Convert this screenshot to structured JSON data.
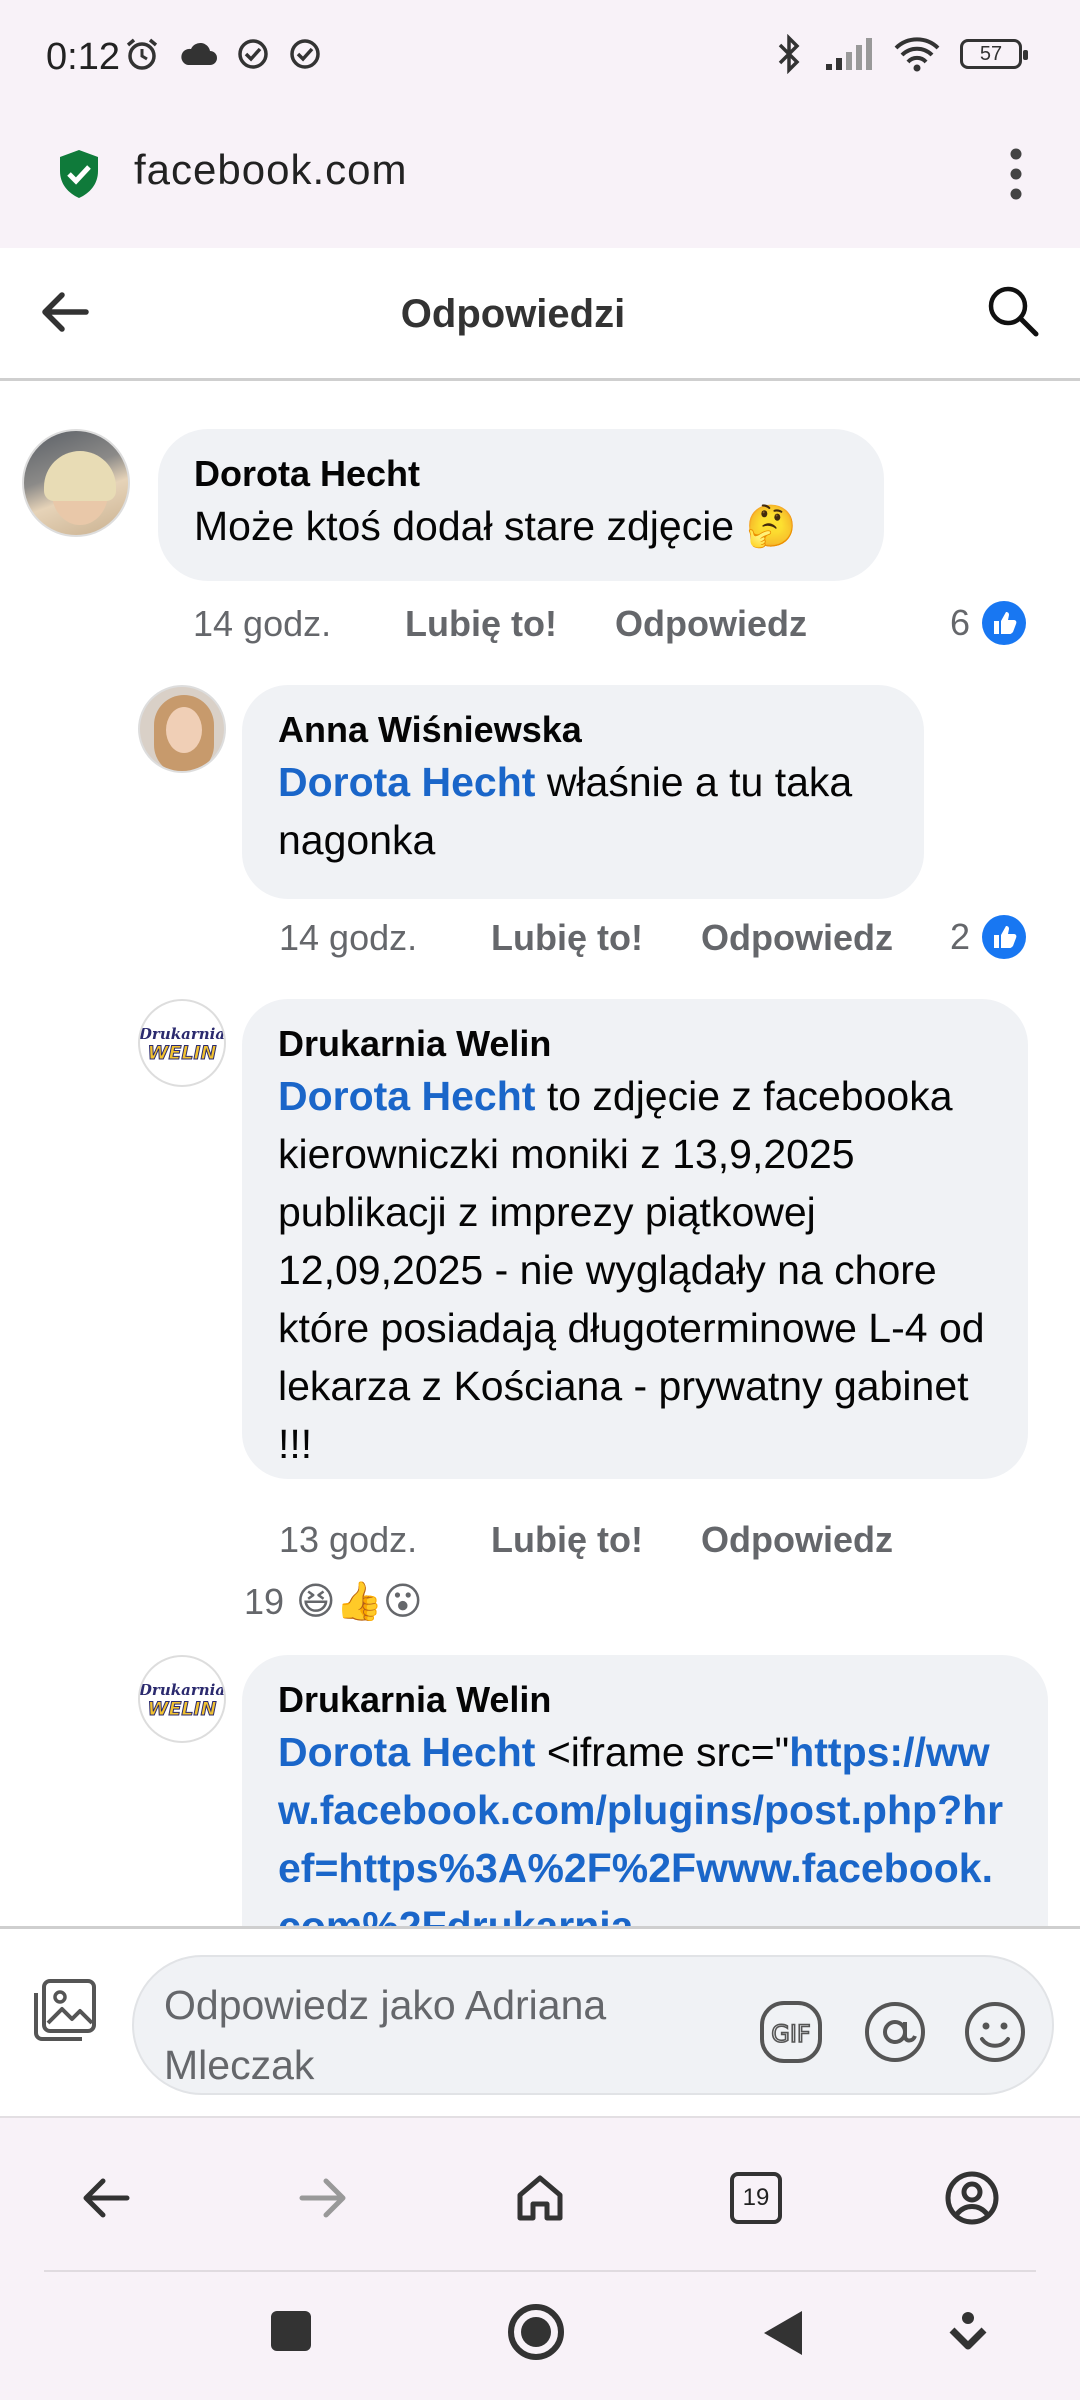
{
  "status_bar": {
    "time": "0:12",
    "battery": "57"
  },
  "browser": {
    "url": "facebook.com",
    "tab_count": "19"
  },
  "header": {
    "title": "Odpowiedzi"
  },
  "comments": [
    {
      "author": "Dorota Hecht",
      "text": "Może ktoś dodał stare zdjęcie 🤔",
      "time": "14 godz.",
      "like_label": "Lubię to!",
      "reply_label": "Odpowiedz",
      "reactions": "6"
    },
    {
      "author": "Anna Wiśniewska",
      "mention": "Dorota Hecht",
      "text": " właśnie a tu taka nagonka",
      "time": "14 godz.",
      "like_label": "Lubię to!",
      "reply_label": "Odpowiedz",
      "reactions": "2"
    },
    {
      "author": "Drukarnia Welin",
      "mention": "Dorota Hecht",
      "text": " to zdjęcie z facebooka kierowniczki moniki z 13,9,2025 publikacji z imprezy piątkowej 12,09,2025 - nie wyglądały na chore które posiadają długoterminowe L-4 od lekarza z Kościana - prywatny gabinet !!!",
      "time": "13 godz.",
      "like_label": "Lubię to!",
      "reply_label": "Odpowiedz",
      "reactions": "19",
      "reaction_emojis": "😆👍😮"
    },
    {
      "author": "Drukarnia Welin",
      "mention": "Dorota Hecht",
      "text_plain": " <iframe src=\"",
      "text_link": "https://www.facebook.com/plugins/post.php?href=https%3A%2F%2Fwww.facebook.com%2Fdrukarnia"
    }
  ],
  "avatar_logo_text": "Drukarnia WELIN",
  "composer": {
    "placeholder": "Odpowiedz jako Adriana Mleczak",
    "gif_label": "GIF"
  },
  "colors": {
    "accent": "#1877f2",
    "mention": "#1a66c9",
    "bubble": "#f0f2f5",
    "shield": "#0f7a3a"
  }
}
